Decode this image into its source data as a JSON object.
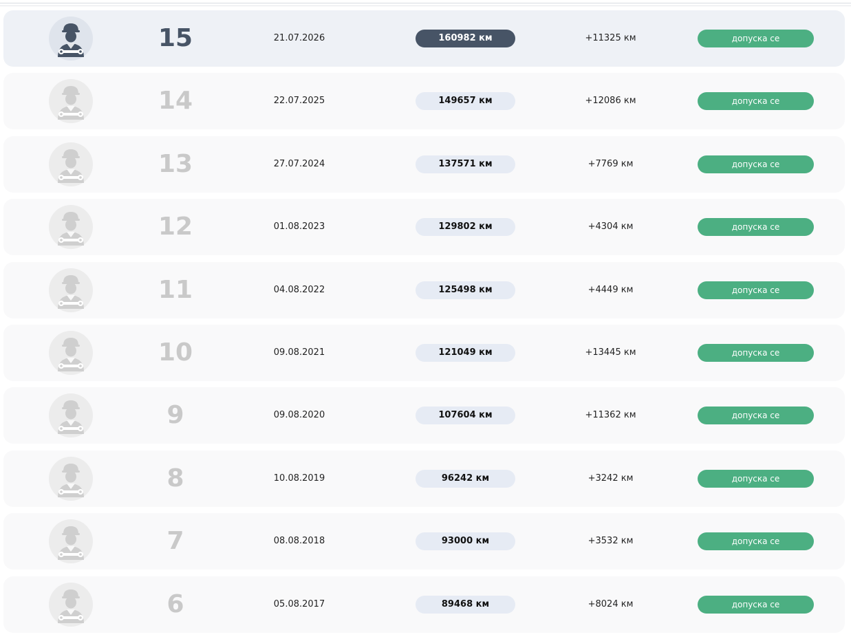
{
  "inspections": [
    {
      "number": "15",
      "date": "21.07.2026",
      "mileage": "160982 км",
      "difference": "+11325 км",
      "status": "допуска се",
      "active": true
    },
    {
      "number": "14",
      "date": "22.07.2025",
      "mileage": "149657 км",
      "difference": "+12086 км",
      "status": "допуска се",
      "active": false
    },
    {
      "number": "13",
      "date": "27.07.2024",
      "mileage": "137571 км",
      "difference": "+7769 км",
      "status": "допуска се",
      "active": false
    },
    {
      "number": "12",
      "date": "01.08.2023",
      "mileage": "129802 км",
      "difference": "+4304 км",
      "status": "допуска се",
      "active": false
    },
    {
      "number": "11",
      "date": "04.08.2022",
      "mileage": "125498 км",
      "difference": "+4449 км",
      "status": "допуска се",
      "active": false
    },
    {
      "number": "10",
      "date": "09.08.2021",
      "mileage": "121049 км",
      "difference": "+13445 км",
      "status": "допуска се",
      "active": false
    },
    {
      "number": "9",
      "date": "09.08.2020",
      "mileage": "107604 км",
      "difference": "+11362 км",
      "status": "допуска се",
      "active": false
    },
    {
      "number": "8",
      "date": "10.08.2019",
      "mileage": "96242 км",
      "difference": "+3242 км",
      "status": "допуска се",
      "active": false
    },
    {
      "number": "7",
      "date": "08.08.2018",
      "mileage": "93000 км",
      "difference": "+3532 км",
      "status": "допуска се",
      "active": false
    },
    {
      "number": "6",
      "date": "05.08.2017",
      "mileage": "89468 км",
      "difference": "+8024 км",
      "status": "допуска се",
      "active": false
    }
  ],
  "icons": {
    "avatar": "mechanic-icon"
  },
  "colors": {
    "active_accent": "#475466",
    "inactive_number": "#c9c9c9",
    "status_green": "#4caf82",
    "mileage_pill": "#e6ebf4"
  }
}
